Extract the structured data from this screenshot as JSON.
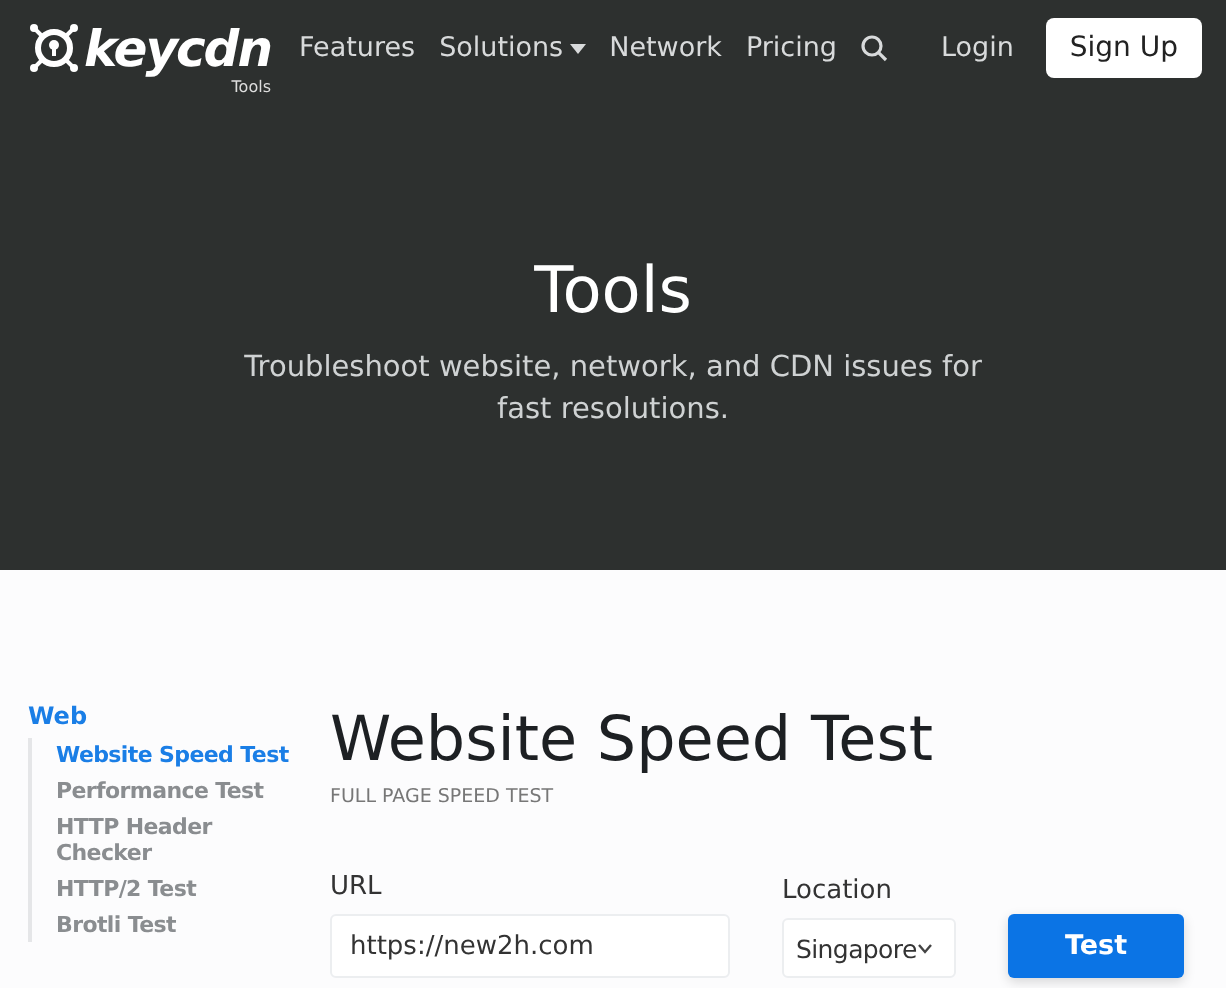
{
  "nav": {
    "logo": "keycdn",
    "logo_sub": "Tools",
    "links": [
      {
        "label": "Features",
        "dropdown": false
      },
      {
        "label": "Solutions",
        "dropdown": true
      },
      {
        "label": "Network",
        "dropdown": false
      },
      {
        "label": "Pricing",
        "dropdown": false
      }
    ],
    "login": "Login",
    "signup": "Sign Up"
  },
  "hero": {
    "title": "Tools",
    "subtitle": "Troubleshoot website, network, and CDN issues for fast resolutions."
  },
  "sidebar": {
    "heading": "Web",
    "items": [
      {
        "label": "Website Speed Test",
        "selected": true
      },
      {
        "label": "Performance Test",
        "selected": false
      },
      {
        "label": "HTTP Header Checker",
        "selected": false
      },
      {
        "label": "HTTP/2 Test",
        "selected": false
      },
      {
        "label": "Brotli Test",
        "selected": false
      }
    ]
  },
  "main": {
    "title": "Website Speed Test",
    "subtitle": "FULL PAGE SPEED TEST",
    "url_label": "URL",
    "url_value": "https://new2h.com",
    "location_label": "Location",
    "location_value": "Singapore",
    "button": "Test"
  }
}
